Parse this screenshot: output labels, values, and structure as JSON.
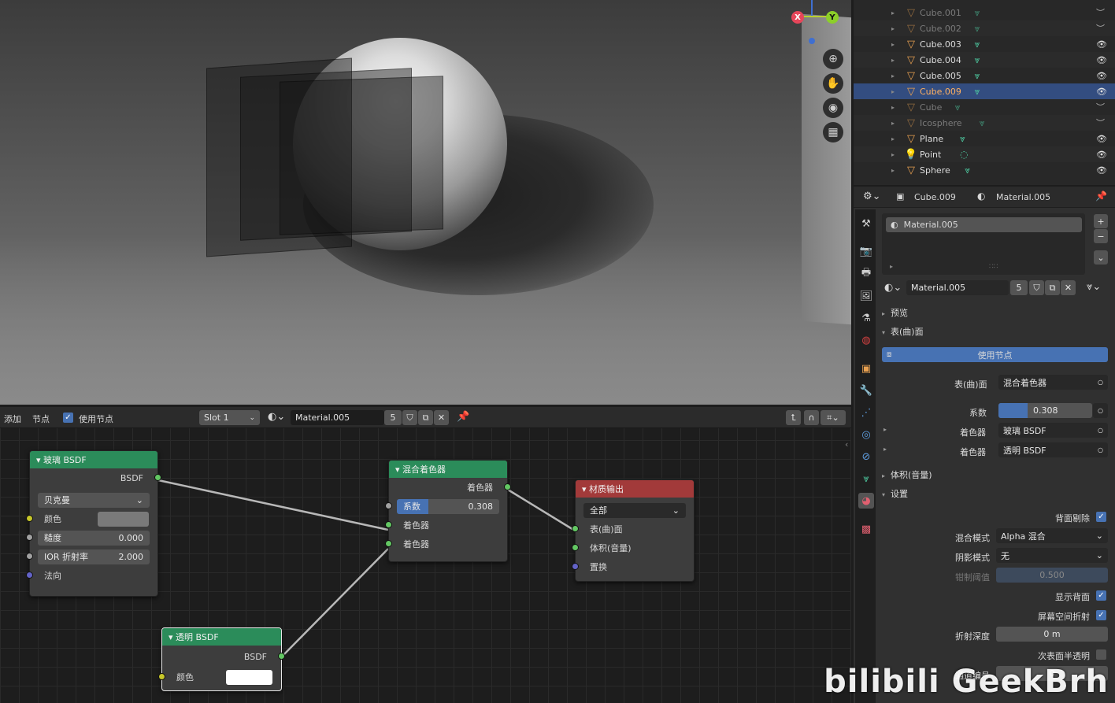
{
  "outliner": {
    "items": [
      {
        "name": "Cube.001",
        "dim": true,
        "vis": "︶"
      },
      {
        "name": "Cube.002",
        "dim": true,
        "vis": "︶"
      },
      {
        "name": "Cube.003",
        "dim": false,
        "vis": "👁"
      },
      {
        "name": "Cube.004",
        "dim": false,
        "vis": "👁"
      },
      {
        "name": "Cube.005",
        "dim": false,
        "vis": "👁"
      },
      {
        "name": "Cube.009",
        "dim": false,
        "vis": "👁",
        "selected": true
      },
      {
        "name": "Cube",
        "dim": true,
        "vis": "︶"
      },
      {
        "name": "Icosphere",
        "dim": true,
        "vis": "︶"
      },
      {
        "name": "Plane",
        "dim": false,
        "vis": "👁"
      },
      {
        "name": "Point",
        "dim": false,
        "vis": "👁"
      },
      {
        "name": "Sphere",
        "dim": false,
        "vis": "👁"
      }
    ]
  },
  "props": {
    "header_object": "Cube.009",
    "header_material": "Material.005",
    "slot_material": "Material.005",
    "mat_name": "Material.005",
    "mat_users": "5",
    "sec_preview": "预览",
    "sec_surface": "表(曲)面",
    "use_nodes": "使用节点",
    "surface_label": "表(曲)面",
    "surface_value": "混合着色器",
    "fac_label": "系数",
    "fac_value": "0.308",
    "fac_fraction": 0.308,
    "shader1_label": "着色器",
    "shader1_value": "玻璃 BSDF",
    "shader2_label": "着色器",
    "shader2_value": "透明 BSDF",
    "sec_volume": "体积(音量)",
    "sec_settings": "设置",
    "backface_label": "背面剔除",
    "blend_label": "混合模式",
    "blend_value": "Alpha 混合",
    "shadow_label": "阴影模式",
    "shadow_value": "无",
    "clip_label": "钳制阈值",
    "clip_value": "0.500",
    "show_back_label": "显示背面",
    "ssr_label": "屏幕空间折射",
    "refr_depth_label": "折射深度",
    "refr_depth_value": "0 m",
    "sss_label": "次表面半透明",
    "pass_label": "通道编号",
    "pass_value": "0"
  },
  "node_header": {
    "add": "添加",
    "node": "节点",
    "use_nodes": "使用节点",
    "slot": "Slot 1",
    "material": "Material.005",
    "users": "5"
  },
  "nodes": {
    "glass": {
      "title": "玻璃 BSDF",
      "out": "BSDF",
      "dist": "贝克曼",
      "color": "颜色",
      "rough_label": "糙度",
      "rough_value": "0.000",
      "ior_label": "IOR 折射率",
      "ior_value": "2.000",
      "normal": "法向"
    },
    "mix": {
      "title": "混合着色器",
      "out": "着色器",
      "fac_label": "系数",
      "fac_value": "0.308",
      "fac_fraction": 0.308,
      "in1": "着色器",
      "in2": "着色器"
    },
    "output": {
      "title": "材质输出",
      "target": "全部",
      "surface": "表(曲)面",
      "volume": "体积(音量)",
      "disp": "置换"
    },
    "transparent": {
      "title": "透明 BSDF",
      "out": "BSDF",
      "color": "颜色"
    }
  },
  "gizmo": {
    "x": "X",
    "y": "Y"
  },
  "watermark": "bilibili GeekBrh",
  "colors": {
    "accent": "#4772b3",
    "selected_row": "#334d80",
    "node_shader_header": "#2b8c5a",
    "node_output_header": "#a23a3a",
    "socket_shader": "#63c763",
    "socket_color": "#c7c729",
    "socket_float": "#a1a1a1",
    "socket_vector": "#6363c7"
  }
}
